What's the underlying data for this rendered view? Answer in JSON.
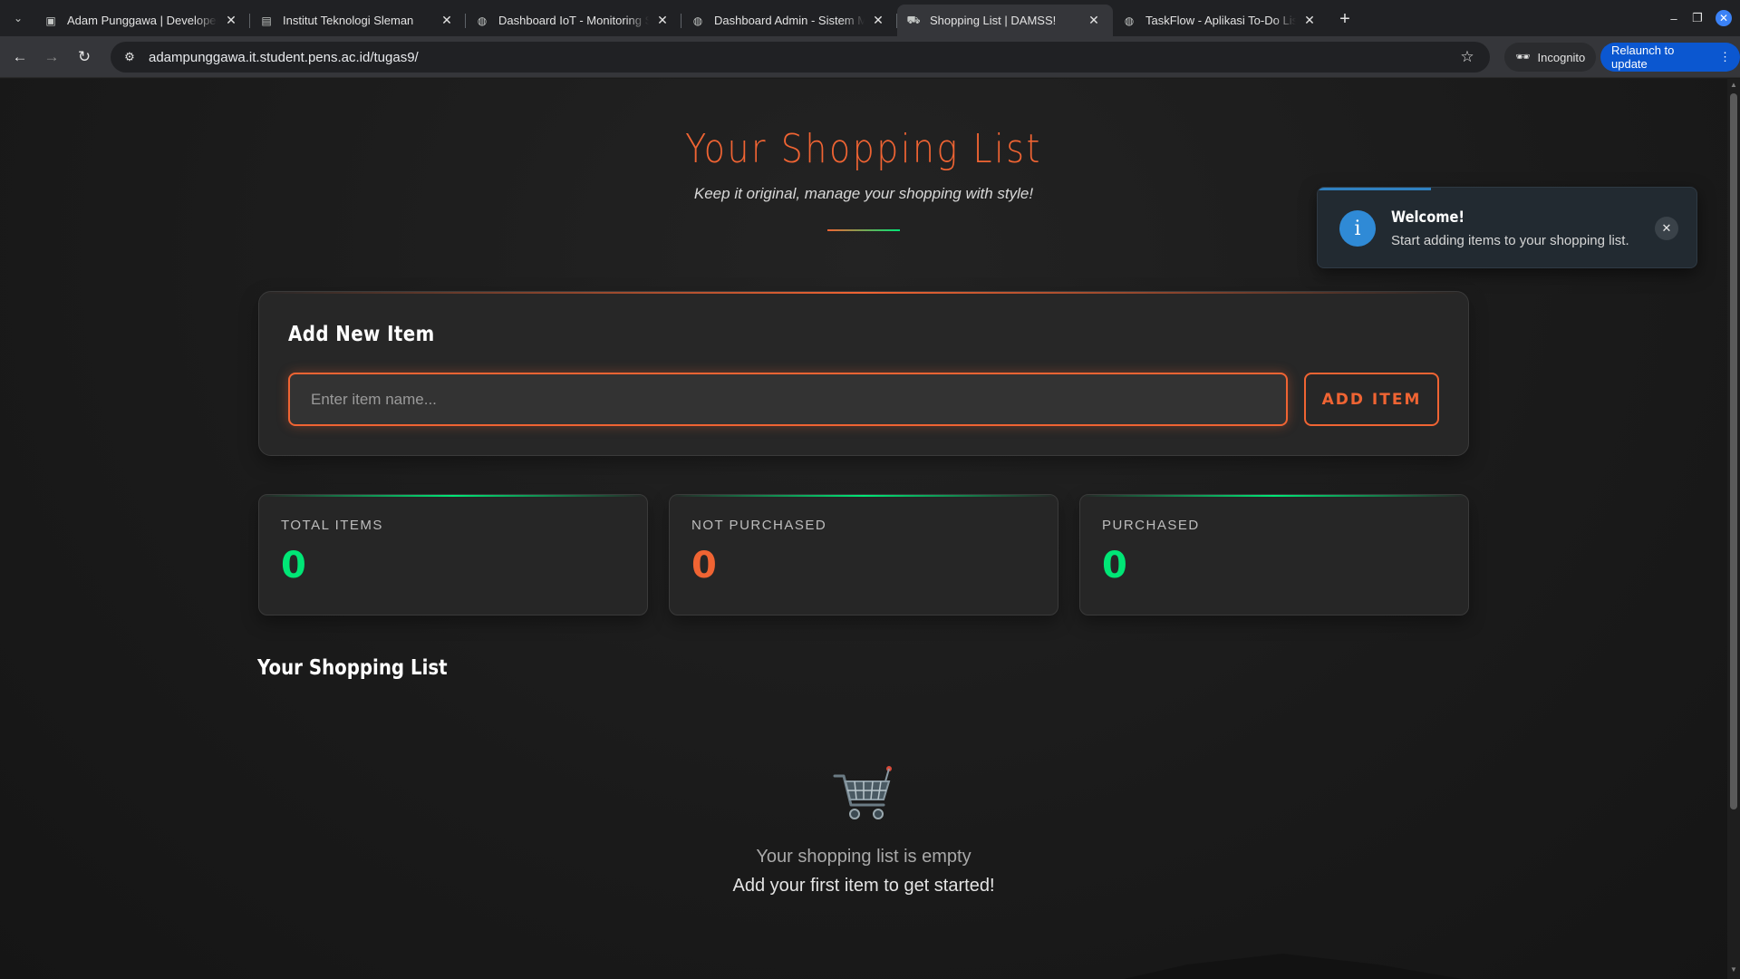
{
  "browser": {
    "tabs": [
      {
        "title": "Adam Punggawa | Developer",
        "icon": "portrait-icon",
        "active": false
      },
      {
        "title": "Institut Teknologi Sleman",
        "icon": "page-icon",
        "active": false
      },
      {
        "title": "Dashboard IoT - Monitoring S",
        "icon": "globe-icon",
        "active": false
      },
      {
        "title": "Dashboard Admin - Sistem M",
        "icon": "globe-icon",
        "active": false
      },
      {
        "title": "Shopping List | DAMSS!",
        "icon": "cart-icon",
        "active": true
      },
      {
        "title": "TaskFlow - Aplikasi To-Do List",
        "icon": "globe-icon",
        "active": false
      }
    ],
    "url": "adampunggawa.it.student.pens.ac.id/tugas9/",
    "incognito_label": "Incognito",
    "relaunch_label": "Relaunch to update"
  },
  "page": {
    "title": "Your Shopping List",
    "subtitle": "Keep it original, manage your shopping with style!",
    "add_card": {
      "title": "Add New Item",
      "input_placeholder": "Enter item name...",
      "input_value": "",
      "button_label": "ADD ITEM"
    },
    "stats": [
      {
        "label": "TOTAL ITEMS",
        "value": "0",
        "color": "#00e676"
      },
      {
        "label": "NOT PURCHASED",
        "value": "0",
        "color": "#f06433"
      },
      {
        "label": "PURCHASED",
        "value": "0",
        "color": "#00e676"
      }
    ],
    "list_title": "Your Shopping List",
    "empty_state": {
      "icon": "shopping-cart-icon",
      "line1": "Your shopping list is empty",
      "line2": "Add your first item to get started!"
    }
  },
  "toast": {
    "title": "Welcome!",
    "message": "Start adding items to your shopping list.",
    "icon": "info-icon"
  },
  "colors": {
    "accent_orange": "#f06433",
    "accent_green": "#00e676",
    "info_blue": "#2f8ad6"
  }
}
